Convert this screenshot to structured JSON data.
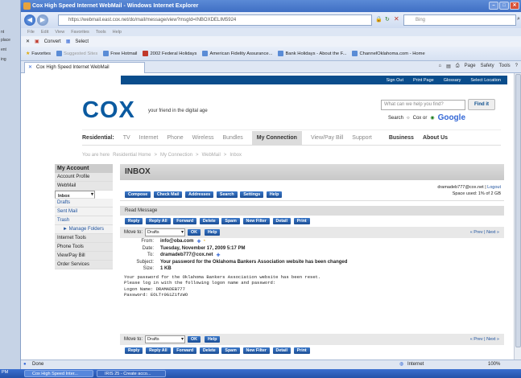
{
  "browser": {
    "title": "Cox High Speed Internet WebMail - Windows Internet Explorer",
    "url": "https://webmail.east.cox.net/do/mail/message/view?msgId=INBOXDELIM5924",
    "search_placeholder": "Bing",
    "menu": [
      "File",
      "Edit",
      "View",
      "Favorites",
      "Tools",
      "Help"
    ],
    "convert_label": "Convert",
    "select_label": "Select",
    "favorites_label": "Favorites",
    "favorites": [
      "Suggested Sites",
      "Free Hotmail",
      "2002 Federal Holidays",
      "American Fidelity Assurance...",
      "Bank Holidays - About the F...",
      "ChannelOklahoma.com - Home"
    ],
    "tab_title": "Cox High Speed Internet WebMail",
    "tab_tools": [
      "Page",
      "Safety",
      "Tools"
    ],
    "status": "Done",
    "zone": "Internet",
    "zoom": "100%",
    "taskbar": [
      "Cox High Speed Inter...",
      "IRIS 25 - Create acco..."
    ],
    "left_strip": [
      "nt",
      "place",
      "ent",
      "ing"
    ]
  },
  "site": {
    "topnav": [
      "Sign Out",
      "Print Page",
      "Glossary",
      "Select Location"
    ],
    "logo": "COX",
    "tagline": "your friend in the digital age",
    "search_placeholder": "What can we help you find?",
    "find_label": "Find it",
    "search_label": "Search",
    "search_opt_cox": "Cox or",
    "search_opt_google": "Google",
    "nav_residential": "Residential:",
    "nav": [
      "TV",
      "Internet",
      "Phone",
      "Wireless",
      "Bundles",
      "My Connection",
      "View/Pay Bill",
      "Support"
    ],
    "nav_business": "Business",
    "nav_about": "About Us",
    "breadcrumb": [
      "You are here",
      "Residential Home",
      ">",
      "My Connection",
      ">",
      "WebMail",
      ">",
      "Inbox"
    ]
  },
  "sidebar": {
    "header": "My Account",
    "items": [
      "Account Profile",
      "WebMail",
      "Inbox",
      "Drafts",
      "Sent Mail",
      "Trash",
      "Manage Folders",
      "Internet Tools",
      "Phone Tools",
      "View/Pay Bill",
      "Order Services"
    ]
  },
  "inbox": {
    "title": "INBOX",
    "toolbar": [
      "Compose",
      "Check Mail",
      "Addresses",
      "Search",
      "Settings",
      "Help"
    ],
    "account": "dramadeb777@cox.net",
    "logout": "Logout",
    "space": "Space used: 1% of 2 GB",
    "read_title": "Read Message",
    "actions": [
      "Reply",
      "Reply All",
      "Forward",
      "Delete",
      "Spam",
      "New Filter",
      "Detail",
      "Print"
    ],
    "move_label": "Move to:",
    "move_value": "Drafts",
    "ok": "OK",
    "help": "Help",
    "prev": "« Prev",
    "next": "Next »",
    "headers": [
      {
        "label": "From:",
        "value": "info@oba.com"
      },
      {
        "label": "Date:",
        "value": "Tuesday, November 17, 2009 5:17 PM"
      },
      {
        "label": "To:",
        "value": "dramadeb777@cox.net"
      },
      {
        "label": "Subject:",
        "value": "Your password for the Oklahoma Bankers Association website has been changed"
      },
      {
        "label": "Size:",
        "value": "1 KB"
      }
    ],
    "body": [
      "Your password for the Oklahoma Bankers Association website has been reset.",
      "Please log in with the following logon name and password:",
      "Logon Name: DRAMADEB777",
      "Password: EOLTr0G1Z1fzWO"
    ]
  }
}
